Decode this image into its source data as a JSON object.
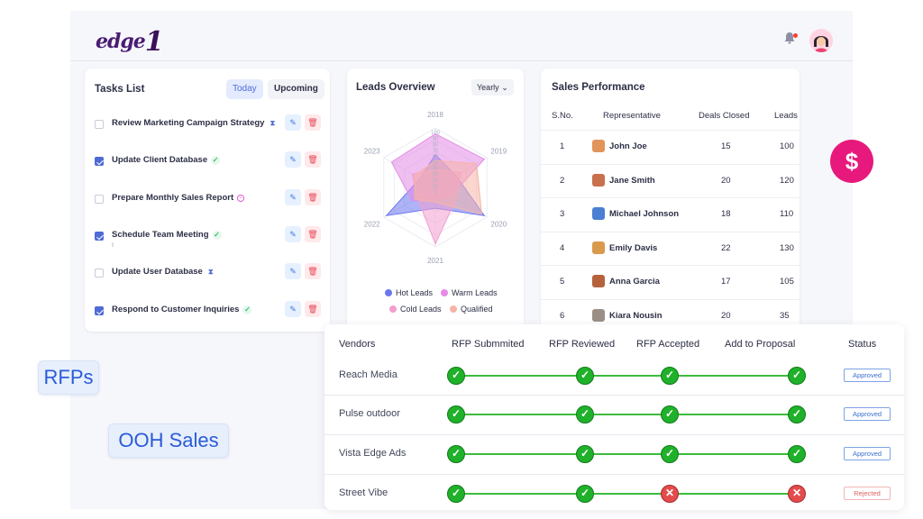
{
  "brand": {
    "logo_text": "edge",
    "logo_num": "1"
  },
  "tasks": {
    "title": "Tasks List",
    "tab_today": "Today",
    "tab_upcoming": "Upcoming",
    "items": [
      {
        "label": "Review Marketing Campaign Strategy",
        "checked": false,
        "status": "pending"
      },
      {
        "label": "Update Client Database",
        "checked": true,
        "status": "done"
      },
      {
        "label": "Prepare Monthly Sales Report",
        "checked": false,
        "status": "progress"
      },
      {
        "label": "Schedule Team Meeting",
        "checked": true,
        "status": "done",
        "sub": "I"
      },
      {
        "label": "Update User Database",
        "checked": false,
        "status": "pending"
      },
      {
        "label": "Respond to Customer Inquiries",
        "checked": true,
        "status": "done"
      }
    ]
  },
  "leads": {
    "title": "Leads Overview",
    "period": "Yearly",
    "radar": {
      "axes": [
        "2018",
        "2019",
        "2020",
        "2021",
        "2022",
        "2023"
      ],
      "scale": [
        "100",
        "90",
        "80",
        "70",
        "60",
        "50",
        "40",
        "30",
        "20",
        "10",
        "0"
      ],
      "series": [
        {
          "name": "Hot Leads",
          "color": "#6c75f0",
          "values": [
            55,
            40,
            95,
            35,
            95,
            30
          ]
        },
        {
          "name": "Warm Leads",
          "color": "#e48be6",
          "values": [
            90,
            95,
            30,
            20,
            45,
            85
          ]
        },
        {
          "name": "Cold Leads",
          "color": "#f29ed0",
          "values": [
            30,
            50,
            40,
            95,
            35,
            45
          ]
        },
        {
          "name": "Qualified",
          "color": "#f6b4a7",
          "values": [
            45,
            80,
            90,
            25,
            40,
            40
          ]
        }
      ]
    },
    "legend": [
      "Hot Leads",
      "Warm Leads",
      "Cold Leads",
      "Qualified"
    ]
  },
  "sales": {
    "title": "Sales Performance",
    "columns": [
      "S.No.",
      "Representative",
      "Deals Closed",
      "Leads"
    ],
    "rows": [
      {
        "n": "1",
        "name": "John Joe",
        "deals": "15",
        "leads": "100",
        "avatar": "#e2955a"
      },
      {
        "n": "2",
        "name": "Jane Smith",
        "deals": "20",
        "leads": "120",
        "avatar": "#c9704d"
      },
      {
        "n": "3",
        "name": "Michael Johnson",
        "deals": "18",
        "leads": "110",
        "avatar": "#4b7fd4"
      },
      {
        "n": "4",
        "name": "Emily Davis",
        "deals": "22",
        "leads": "130",
        "avatar": "#d99a4e"
      },
      {
        "n": "5",
        "name": "Anna Garcia",
        "deals": "17",
        "leads": "105",
        "avatar": "#b5623c"
      },
      {
        "n": "6",
        "name": "Kiara Nousin",
        "deals": "20",
        "leads": "35",
        "avatar": "#9a8f86"
      }
    ]
  },
  "rfp": {
    "headers": [
      "Vendors",
      "RFP Submmited",
      "RFP Reviewed",
      "RFP Accepted",
      "Add to Proposal",
      "Status"
    ],
    "rows": [
      {
        "vendor": "Reach Media",
        "steps": [
          "ok",
          "ok",
          "ok",
          "ok"
        ],
        "status": "Approved"
      },
      {
        "vendor": "Pulse outdoor",
        "steps": [
          "ok",
          "ok",
          "ok",
          "ok"
        ],
        "status": "Approved"
      },
      {
        "vendor": "Vista Edge Ads",
        "steps": [
          "ok",
          "ok",
          "ok",
          "ok"
        ],
        "status": "Approved"
      },
      {
        "vendor": "Street Vibe",
        "steps": [
          "ok",
          "ok",
          "no",
          "no"
        ],
        "status": "Rejected"
      }
    ]
  },
  "pills": {
    "rfps": "RFPs",
    "ooh": "OOH Sales"
  },
  "icons": {
    "dollar": "$"
  }
}
